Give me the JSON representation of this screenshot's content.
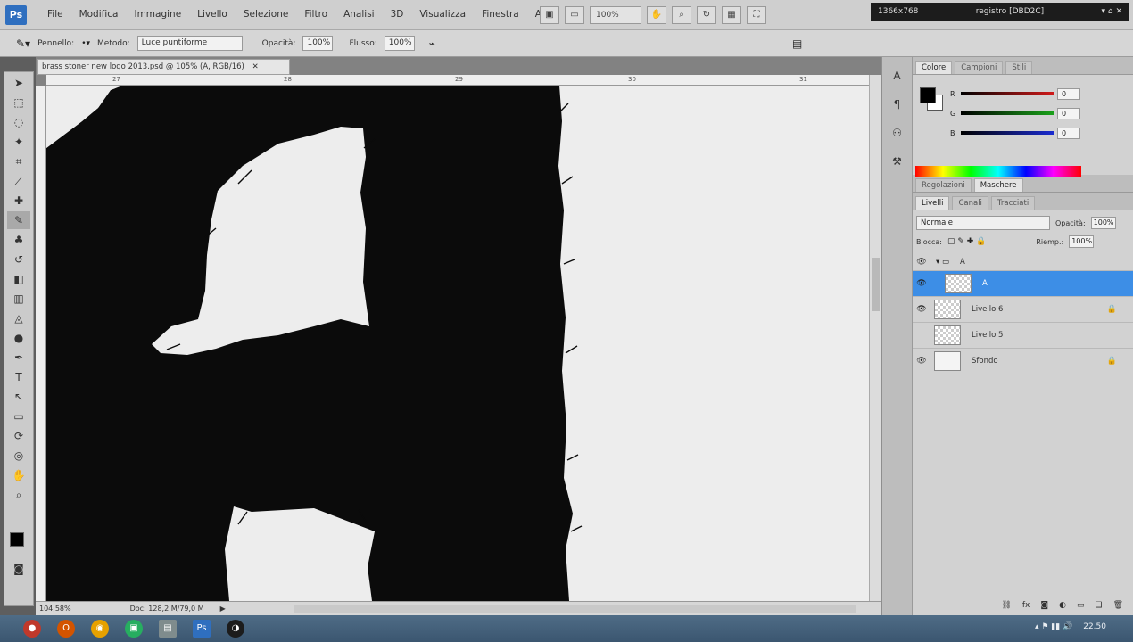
{
  "app": {
    "logo": "Ps",
    "menu": [
      "File",
      "Modifica",
      "Immagine",
      "Livello",
      "Selezione",
      "Filtro",
      "Analisi",
      "3D",
      "Visualizza",
      "Finestra",
      "Aiuto"
    ]
  },
  "appbar": {
    "zoom": "100%"
  },
  "status_top": {
    "resolution": "1366x768",
    "info": "registro [DBD2C]"
  },
  "options": {
    "brush_label": "Pennello:",
    "mode_label": "Metodo:",
    "mode_value": "Luce puntiforme",
    "opacity_label": "Opacità:",
    "opacity_value": "100%",
    "flow_label": "Flusso:",
    "flow_value": "100%"
  },
  "document": {
    "tab": "brass stoner new logo 2013.psd @ 105% (A, RGB/16)",
    "status_zoom": "104,58%",
    "status_doc": "Doc: 128,2 M/79,0 M"
  },
  "ruler": {
    "h_ticks": [
      "27",
      "28",
      "29",
      "30",
      "31"
    ]
  },
  "color_panel": {
    "tabs": [
      "Colore",
      "Campioni",
      "Stili"
    ],
    "channels": [
      {
        "name": "R",
        "value": "0",
        "color": "#d01a1a"
      },
      {
        "name": "G",
        "value": "0",
        "color": "#1aa11a"
      },
      {
        "name": "B",
        "value": "0",
        "color": "#1a2bd0"
      }
    ]
  },
  "adjust_panel": {
    "tabs": [
      "Regolazioni",
      "Maschere"
    ]
  },
  "layers_panel": {
    "tabs": [
      "Livelli",
      "Canali",
      "Tracciati"
    ],
    "blend_mode": "Normale",
    "opacity_label": "Opacità:",
    "opacity_value": "100%",
    "lock_label": "Blocca:",
    "fill_label": "Riemp.:",
    "fill_value": "100%",
    "group_name": "A",
    "layers": [
      {
        "name": "A",
        "selected": true,
        "visible": true,
        "locked": false
      },
      {
        "name": "Livello 6",
        "selected": false,
        "visible": true,
        "locked": true
      },
      {
        "name": "Livello 5",
        "selected": false,
        "visible": false,
        "locked": false
      },
      {
        "name": "Sfondo",
        "selected": false,
        "visible": true,
        "locked": true
      }
    ]
  },
  "taskbar": {
    "clock": "22.50"
  }
}
